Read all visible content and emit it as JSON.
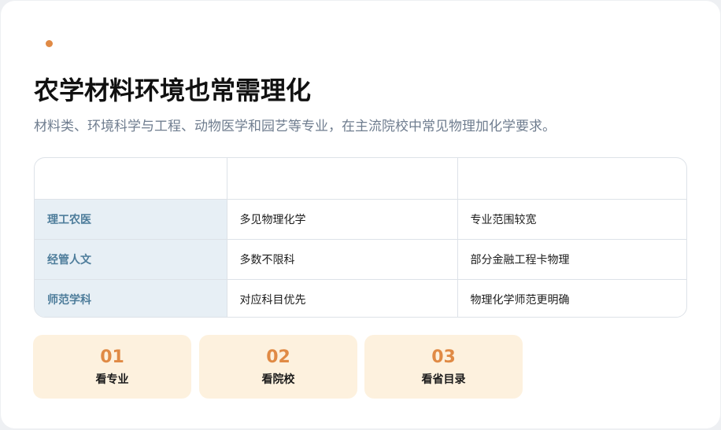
{
  "header": {
    "title": "农学材料环境也常需理化",
    "subtitle": "材料类、环境科学与工程、动物医学和园艺等专业，在主流院校中常见物理加化学要求。"
  },
  "table": {
    "columns": [
      "",
      "",
      ""
    ],
    "rows": [
      {
        "category": "理工农医",
        "requirement": "多见物理化学",
        "note": "专业范围较宽"
      },
      {
        "category": "经管人文",
        "requirement": "多数不限科",
        "note": "部分金融工程卡物理"
      },
      {
        "category": "师范学科",
        "requirement": "对应科目优先",
        "note": "物理化学师范更明确"
      }
    ]
  },
  "steps": [
    {
      "num": "01",
      "label": "看专业"
    },
    {
      "num": "02",
      "label": "看院校"
    },
    {
      "num": "03",
      "label": "看省目录"
    }
  ],
  "colors": {
    "accent": "#e08a45",
    "row_header_bg": "#e7eff5",
    "row_header_text": "#4e7d9b",
    "step_bg": "#fdf1de"
  }
}
